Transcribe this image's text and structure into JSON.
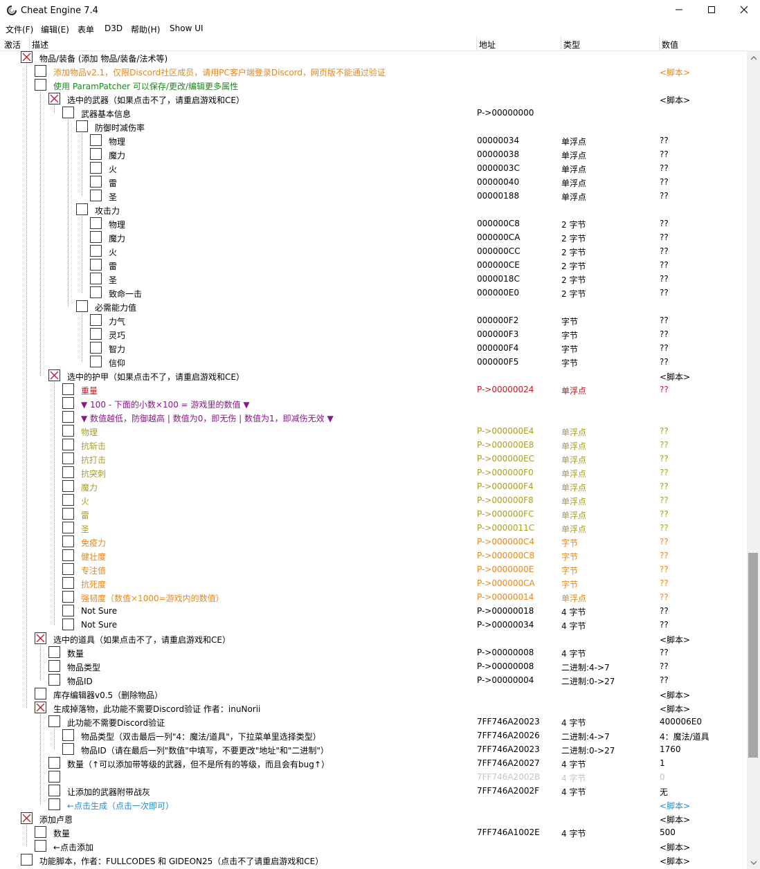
{
  "window": {
    "title": "Cheat Engine 7.4"
  },
  "menu": [
    "文件(F)",
    "编辑(E)",
    "表单",
    "D3D",
    "帮助(H)",
    "Show UI"
  ],
  "columns": {
    "active": "激活",
    "description": "描述",
    "address": "地址",
    "type": "类型",
    "value": "数值"
  },
  "colors": {
    "orange": "#e8861a",
    "green": "#1a8a1a",
    "red": "#c0181d",
    "purple": "#8b158b",
    "olive": "#a8a021",
    "blue": "#1d8fd6",
    "gray": "#c4c4c4"
  },
  "rows": [
    {
      "level": 0,
      "checked": true,
      "desc": "物品/装备 (添加 物品/装备/法术等)",
      "addr": "",
      "type": "",
      "val": "",
      "color": "#000000"
    },
    {
      "level": 1,
      "checked": false,
      "desc": "添加物品v2.1，仅限Discord社区成员，请用PC客户端登录Discord，网页版不能通过验证",
      "addr": "",
      "type": "",
      "val": "<脚本>",
      "color": "#e8861a"
    },
    {
      "level": 1,
      "checked": false,
      "desc": "使用 ParamPatcher 可以保存/更改/编辑更多属性",
      "addr": "",
      "type": "",
      "val": "",
      "color": "#1a8a1a"
    },
    {
      "level": 2,
      "checked": true,
      "desc": "选中的武器（如果点击不了，请重启游戏和CE）",
      "addr": "",
      "type": "",
      "val": "<脚本>",
      "color": "#000000"
    },
    {
      "level": 3,
      "checked": false,
      "desc": "武器基本信息",
      "addr": "P->00000000",
      "type": "",
      "val": "",
      "color": "#000000"
    },
    {
      "level": 4,
      "checked": false,
      "desc": "防御时减伤率",
      "addr": "",
      "type": "",
      "val": "",
      "color": "#000000"
    },
    {
      "level": 5,
      "checked": false,
      "desc": "物理",
      "addr": "00000034",
      "type": "单浮点",
      "val": "??",
      "color": "#000000"
    },
    {
      "level": 5,
      "checked": false,
      "desc": "魔力",
      "addr": "00000038",
      "type": "单浮点",
      "val": "??",
      "color": "#000000"
    },
    {
      "level": 5,
      "checked": false,
      "desc": "火",
      "addr": "0000003C",
      "type": "单浮点",
      "val": "??",
      "color": "#000000"
    },
    {
      "level": 5,
      "checked": false,
      "desc": "雷",
      "addr": "00000040",
      "type": "单浮点",
      "val": "??",
      "color": "#000000"
    },
    {
      "level": 5,
      "checked": false,
      "desc": "圣",
      "addr": "00000188",
      "type": "单浮点",
      "val": "??",
      "color": "#000000"
    },
    {
      "level": 4,
      "checked": false,
      "desc": "攻击力",
      "addr": "",
      "type": "",
      "val": "",
      "color": "#000000"
    },
    {
      "level": 5,
      "checked": false,
      "desc": "物理",
      "addr": "000000C8",
      "type": "2 字节",
      "val": "??",
      "color": "#000000"
    },
    {
      "level": 5,
      "checked": false,
      "desc": "魔力",
      "addr": "000000CA",
      "type": "2 字节",
      "val": "??",
      "color": "#000000"
    },
    {
      "level": 5,
      "checked": false,
      "desc": "火",
      "addr": "000000CC",
      "type": "2 字节",
      "val": "??",
      "color": "#000000"
    },
    {
      "level": 5,
      "checked": false,
      "desc": "雷",
      "addr": "000000CE",
      "type": "2 字节",
      "val": "??",
      "color": "#000000"
    },
    {
      "level": 5,
      "checked": false,
      "desc": "圣",
      "addr": "0000018C",
      "type": "2 字节",
      "val": "??",
      "color": "#000000"
    },
    {
      "level": 5,
      "checked": false,
      "desc": "致命一击",
      "addr": "000000E0",
      "type": "2 字节",
      "val": "??",
      "color": "#000000"
    },
    {
      "level": 4,
      "checked": false,
      "desc": "必需能力值",
      "addr": "",
      "type": "",
      "val": "",
      "color": "#000000"
    },
    {
      "level": 5,
      "checked": false,
      "desc": "力气",
      "addr": "000000F2",
      "type": "字节",
      "val": "??",
      "color": "#000000"
    },
    {
      "level": 5,
      "checked": false,
      "desc": "灵巧",
      "addr": "000000F3",
      "type": "字节",
      "val": "??",
      "color": "#000000"
    },
    {
      "level": 5,
      "checked": false,
      "desc": "智力",
      "addr": "000000F4",
      "type": "字节",
      "val": "??",
      "color": "#000000"
    },
    {
      "level": 5,
      "checked": false,
      "desc": "信仰",
      "addr": "000000F5",
      "type": "字节",
      "val": "??",
      "color": "#000000"
    },
    {
      "level": 2,
      "checked": true,
      "desc": "选中的护甲（如果点击不了，请重启游戏和CE）",
      "addr": "",
      "type": "",
      "val": "<脚本>",
      "color": "#000000"
    },
    {
      "level": 3,
      "checked": false,
      "desc": "重量",
      "addr": "P->00000024",
      "type": "单浮点",
      "val": "??",
      "color": "#c0181d"
    },
    {
      "level": 3,
      "checked": false,
      "desc": "▼ 100 - 下面的小数×100 = 游戏里的数值 ▼",
      "addr": "",
      "type": "",
      "val": "",
      "color": "#8b158b"
    },
    {
      "level": 3,
      "checked": false,
      "desc": "▼ 数值越低，防御越高 | 数值为0，即无伤 | 数值为1，即减伤无效 ▼",
      "addr": "",
      "type": "",
      "val": "",
      "color": "#8b158b"
    },
    {
      "level": 3,
      "checked": false,
      "desc": "物理",
      "addr": "P->000000E4",
      "type": "单浮点",
      "val": "??",
      "color": "#a8a021"
    },
    {
      "level": 3,
      "checked": false,
      "desc": "抗斩击",
      "addr": "P->000000E8",
      "type": "单浮点",
      "val": "??",
      "color": "#a8a021"
    },
    {
      "level": 3,
      "checked": false,
      "desc": "抗打击",
      "addr": "P->000000EC",
      "type": "单浮点",
      "val": "??",
      "color": "#a8a021"
    },
    {
      "level": 3,
      "checked": false,
      "desc": "抗突刺",
      "addr": "P->000000F0",
      "type": "单浮点",
      "val": "??",
      "color": "#a8a021"
    },
    {
      "level": 3,
      "checked": false,
      "desc": "魔力",
      "addr": "P->000000F4",
      "type": "单浮点",
      "val": "??",
      "color": "#a8a021"
    },
    {
      "level": 3,
      "checked": false,
      "desc": "火",
      "addr": "P->000000F8",
      "type": "单浮点",
      "val": "??",
      "color": "#a8a021"
    },
    {
      "level": 3,
      "checked": false,
      "desc": "雷",
      "addr": "P->000000FC",
      "type": "单浮点",
      "val": "??",
      "color": "#a8a021"
    },
    {
      "level": 3,
      "checked": false,
      "desc": "圣",
      "addr": "P->0000011C",
      "type": "单浮点",
      "val": "??",
      "color": "#a8a021"
    },
    {
      "level": 3,
      "checked": false,
      "desc": "免疫力",
      "addr": "P->000000C4",
      "type": "字节",
      "val": "??",
      "color": "#e8861a"
    },
    {
      "level": 3,
      "checked": false,
      "desc": "健壮度",
      "addr": "P->000000C8",
      "type": "字节",
      "val": "??",
      "color": "#e8861a"
    },
    {
      "level": 3,
      "checked": false,
      "desc": "专注值",
      "addr": "P->0000000E",
      "type": "字节",
      "val": "??",
      "color": "#e8861a"
    },
    {
      "level": 3,
      "checked": false,
      "desc": "抗死度",
      "addr": "P->000000CA",
      "type": "字节",
      "val": "??",
      "color": "#e8861a"
    },
    {
      "level": 3,
      "checked": false,
      "desc": "强韧度（数值×1000=游戏内的数值）",
      "addr": "P->00000014",
      "type": "单浮点",
      "val": "??",
      "color": "#e8861a"
    },
    {
      "level": 3,
      "checked": false,
      "desc": "Not Sure",
      "addr": "P->00000018",
      "type": "4 字节",
      "val": "??",
      "color": "#000000"
    },
    {
      "level": 3,
      "checked": false,
      "desc": "Not Sure",
      "addr": "P->00000034",
      "type": "4 字节",
      "val": "??",
      "color": "#000000"
    },
    {
      "level": 1,
      "checked": true,
      "desc": "选中的道具（如果点击不了，请重启游戏和CE）",
      "addr": "",
      "type": "",
      "val": "<脚本>",
      "color": "#000000"
    },
    {
      "level": 2,
      "checked": false,
      "desc": "数量",
      "addr": "P->00000008",
      "type": "4 字节",
      "val": "??",
      "color": "#000000"
    },
    {
      "level": 2,
      "checked": false,
      "desc": "物品类型",
      "addr": "P->00000008",
      "type": "二进制:4->7",
      "val": "??",
      "color": "#000000"
    },
    {
      "level": 2,
      "checked": false,
      "desc": "物品ID",
      "addr": "P->00000004",
      "type": "二进制:0->27",
      "val": "??",
      "color": "#000000"
    },
    {
      "level": 1,
      "checked": false,
      "desc": "库存编辑器v0.5（删除物品）",
      "addr": "",
      "type": "",
      "val": "<脚本>",
      "color": "#000000"
    },
    {
      "level": 1,
      "checked": true,
      "desc": "生成掉落物，此功能不需要Discord验证 作者：inuNorii",
      "addr": "",
      "type": "",
      "val": "<脚本>",
      "color": "#000000"
    },
    {
      "level": 2,
      "checked": false,
      "desc": "此功能不需要Discord验证",
      "addr": "7FF746A20023",
      "type": "4 字节",
      "val": "400006E0",
      "color": "#000000"
    },
    {
      "level": 3,
      "checked": false,
      "desc": "物品类型（双击最后一列\"4：魔法/道具\"，下拉菜单里选择类型）",
      "addr": "7FF746A20026",
      "type": "二进制:4->7",
      "val": "4：魔法/道具",
      "color": "#000000"
    },
    {
      "level": 3,
      "checked": false,
      "desc": "物品ID（请在最后一列\"数值\"中填写，不要更改\"地址\"和\"二进制\"）",
      "addr": "7FF746A20023",
      "type": "二进制:0->27",
      "val": "1760",
      "color": "#000000"
    },
    {
      "level": 2,
      "checked": false,
      "desc": "数量（↑可以添加带等级的武器，但不是所有的等级，而且会有bug↑）",
      "addr": "7FF746A20027",
      "type": "4 字节",
      "val": "1",
      "color": "#000000"
    },
    {
      "level": 2,
      "checked": false,
      "desc": "",
      "addr": "7FF746A2002B",
      "type": "4 字节",
      "val": "0",
      "color": "#c4c4c4"
    },
    {
      "level": 2,
      "checked": false,
      "desc": "让添加的武器附带战灰",
      "addr": "7FF746A2002F",
      "type": "4 字节",
      "val": "无",
      "color": "#000000"
    },
    {
      "level": 2,
      "checked": false,
      "desc": "←点击生成（点击一次即可）",
      "addr": "",
      "type": "",
      "val": "<脚本>",
      "color": "#1d8fd6"
    },
    {
      "level": 0,
      "checked": true,
      "desc": "添加卢恩",
      "addr": "",
      "type": "",
      "val": "<脚本>",
      "color": "#000000"
    },
    {
      "level": 1,
      "checked": false,
      "desc": "数量",
      "addr": "7FF746A1002E",
      "type": "4 字节",
      "val": "500",
      "color": "#000000"
    },
    {
      "level": 1,
      "checked": false,
      "desc": "←点击添加",
      "addr": "",
      "type": "",
      "val": "<脚本>",
      "color": "#000000"
    },
    {
      "level": -1,
      "checked": false,
      "desc": "功能脚本，作者：FULLCODES 和 GIDEON25（点击不了请重启游戏和CE）",
      "addr": "",
      "type": "",
      "val": "<脚本>",
      "color": "#000000"
    }
  ]
}
